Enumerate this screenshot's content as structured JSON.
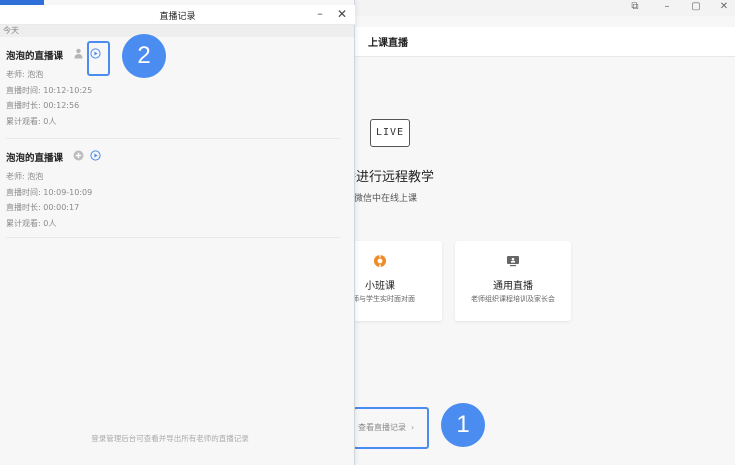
{
  "main": {
    "tab_label": "上课直播",
    "live_badge": "LIVE",
    "hero_title": "直播进行远程教学",
    "hero_subtitle": "在微信中在线上课",
    "cards": [
      {
        "title": "小班课",
        "desc": "老师与学生实时面对面",
        "icon": "orange-class-icon",
        "accent": "#f08a24"
      },
      {
        "title": "通用直播",
        "desc": "老师组织课程培训及家长会",
        "icon": "broadcast-screen-icon",
        "accent": "#555555"
      }
    ],
    "view_records_label": "查看直播记录",
    "view_records_chevron": "›",
    "window_controls": {
      "pin": "⧉",
      "minimize": "–",
      "maximize": "▢",
      "close": "✕"
    }
  },
  "dialog": {
    "title": "直播记录",
    "minimize": "–",
    "close": "✕",
    "section_label": "今天",
    "records": [
      {
        "title": "泡泡的直播课",
        "teacher": "老师: 泡泡",
        "time": "直播时间: 10:12-10:25",
        "duration": "直播时长: 00:12:56",
        "views": "累计观看: 0人"
      },
      {
        "title": "泡泡的直播课",
        "teacher": "老师: 泡泡",
        "time": "直播时间: 10:09-10:09",
        "duration": "直播时长: 00:00:17",
        "views": "累计观看: 0人"
      }
    ],
    "footer": "登录管理后台可查看并导出所有老师的直播记录"
  },
  "callouts": {
    "one": "1",
    "two": "2"
  },
  "colors": {
    "accent_blue": "#4a8cf0",
    "orange": "#f08a24"
  }
}
